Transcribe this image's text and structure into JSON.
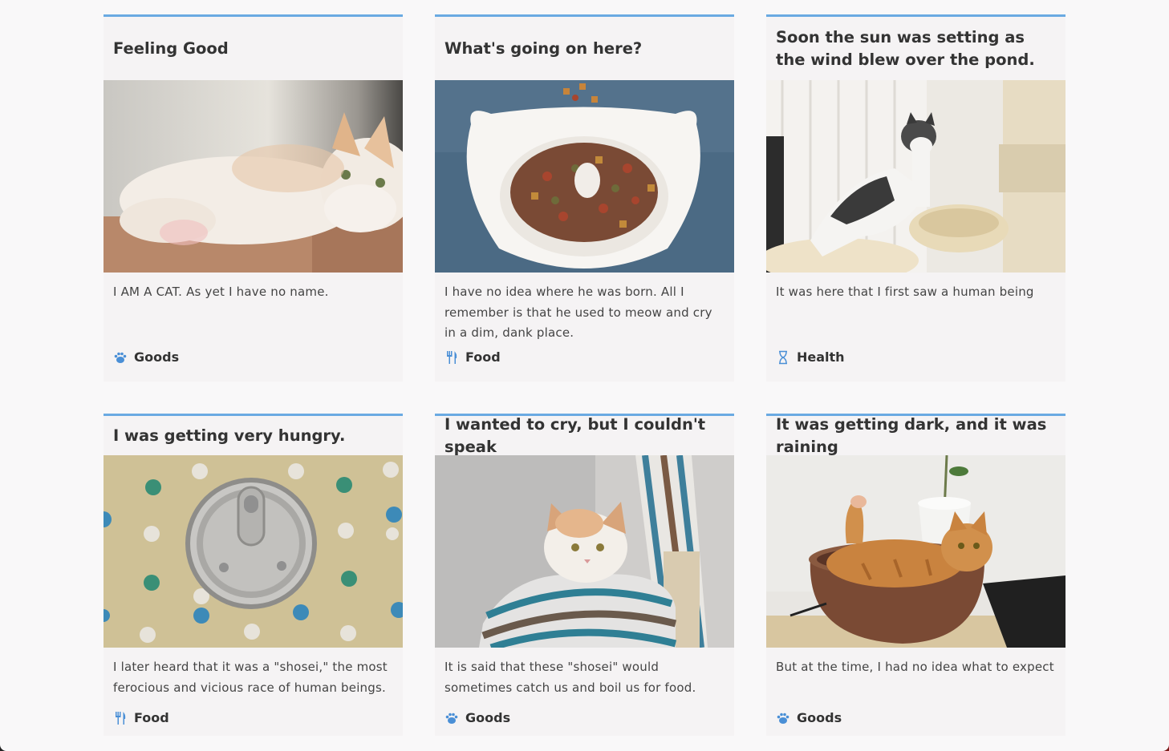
{
  "colors": {
    "accent": "#6aaae2",
    "card_bg": "#f5f3f4",
    "page_bg": "#f9f8f9"
  },
  "cards": [
    {
      "title": "Feeling Good",
      "image": "cat-lying-on-box-photo",
      "description": "I AM A CAT. As yet I have no name.",
      "category": {
        "icon": "paw-icon",
        "label": "Goods"
      }
    },
    {
      "title": "What's going on here?",
      "image": "cat-food-bowl-photo",
      "description": "I have no idea where he was born. All I remember is that he used to meow and cry in a dim, dank place.",
      "category": {
        "icon": "fork-knife-icon",
        "label": "Food"
      }
    },
    {
      "title": "Soon the sun was setting as the wind blew over the pond.",
      "image": "cat-on-cat-tree-photo",
      "description": "It was here that I first saw a human being",
      "category": {
        "icon": "hourglass-icon",
        "label": "Health"
      }
    },
    {
      "title": "I was getting very hungry.",
      "image": "tin-can-on-polka-dots-photo",
      "description": "I later heard that it was a \"shosei,\" the most ferocious and vicious race of human beings.",
      "category": {
        "icon": "fork-knife-icon",
        "label": "Food"
      }
    },
    {
      "title": "I wanted to cry, but I couldn't speak",
      "image": "cat-in-striped-bag-photo",
      "description": "It is said that these \"shosei\" would sometimes catch us and boil us for food.",
      "category": {
        "icon": "paw-icon",
        "label": "Goods"
      }
    },
    {
      "title": "It was getting dark, and it was raining",
      "image": "orange-cat-in-pot-photo",
      "description": "But at the time, I had no idea what to expect",
      "category": {
        "icon": "paw-icon",
        "label": "Goods"
      }
    }
  ]
}
